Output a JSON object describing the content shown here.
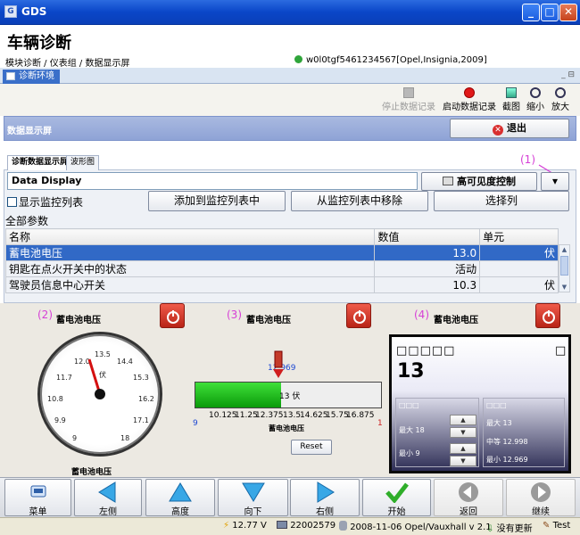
{
  "window": {
    "title": "GDS",
    "app_icon_text": "G"
  },
  "header": {
    "title": "车辆诊断",
    "breadcrumb": "模块诊断 / 仪表组 / 数据显示屏",
    "vehicle_id": "w0l0tgf5461234567[Opel,Insignia,2009]"
  },
  "env_tab": {
    "label": "诊断环境",
    "controls": "_ ⊟"
  },
  "toolbar": {
    "stop_record": "停止数据记录",
    "start_record": "启动数据记录",
    "screenshot": "截图",
    "zoom_out": "缩小",
    "zoom_in": "放大"
  },
  "screen": {
    "title": "数据显示屏",
    "exit_label": "退出"
  },
  "inner_tabs": [
    {
      "label": "诊断数据显示屏"
    },
    {
      "label": "波形图"
    }
  ],
  "display": {
    "selected": "Data Display",
    "high_visibility_label": "高可见度控制",
    "dropdown_arrow": "▾",
    "callout": "(1)"
  },
  "monitor": {
    "show_list_label": "显示监控列表",
    "add_label": "添加到监控列表中",
    "remove_label": "从监控列表中移除",
    "select_cols_label": "选择列"
  },
  "params": {
    "section_label": "全部参数",
    "headers": [
      "名称",
      "数值",
      "单元"
    ],
    "rows": [
      {
        "name": "蓄电池电压",
        "value": "13.0",
        "unit": "伏",
        "selected": true
      },
      {
        "name": "钥匙在点火开关中的状态",
        "value": "活动",
        "unit": ""
      },
      {
        "name": "驾驶员信息中心开关",
        "value": "10.3",
        "unit": "伏"
      }
    ]
  },
  "gauges": {
    "g1": {
      "callout": "(2)",
      "title": "蓄电池电压",
      "label": "蓄电池电压",
      "unit": "伏",
      "ticks": [
        "12.0",
        "13.5",
        "14.4",
        "11.7",
        "15.3",
        "10.8",
        "16.2",
        "9.9",
        "17.1",
        "9",
        "18"
      ]
    },
    "g2": {
      "callout": "(3)",
      "title": "蓄电池电压",
      "value_label": "12.969",
      "reading": "13  伏",
      "ticks": [
        "10.125",
        "11.25",
        "12.375",
        "13.5",
        "14.625",
        "15.75",
        "16.875"
      ],
      "end_left": "9",
      "end_right": "1",
      "caption": "蓄电池电压",
      "reset_label": "Reset",
      "fill_fraction": 0.46
    },
    "g3": {
      "callout": "(4)",
      "title": "蓄电池电压",
      "garble": "□□□□□",
      "garble_right": "□",
      "big_value": "13",
      "left_box": {
        "head": "□□□",
        "max": "最大 18",
        "min": "最小 9"
      },
      "right_box": {
        "head": "□□□",
        "max": "最大 13",
        "mid": "中等 12.998",
        "min": "最小 12.969"
      }
    }
  },
  "nav": [
    {
      "label": "菜单"
    },
    {
      "label": "左侧"
    },
    {
      "label": "高度"
    },
    {
      "label": "向下"
    },
    {
      "label": "右侧"
    },
    {
      "label": "开始"
    },
    {
      "label": "返回"
    },
    {
      "label": "继续"
    }
  ],
  "status": {
    "voltage": "12.77 V",
    "counter": "22002579",
    "version": "2008-11-06 Opel/Vauxhall v 2.1",
    "update": "没有更新",
    "mode": "Test"
  },
  "colors": {
    "selection": "#3169c6",
    "titlebar": "#0a46c8",
    "callout": "#d63fd6",
    "gauge_fill": "#1fbf1a"
  }
}
